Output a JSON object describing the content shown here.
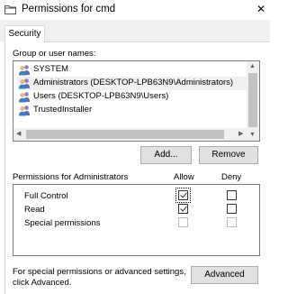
{
  "window": {
    "title": "Permissions for cmd",
    "close_glyph": "✕"
  },
  "tabs": [
    {
      "label": "Security",
      "active": true
    }
  ],
  "users": {
    "label": "Group or user names:",
    "items": [
      {
        "name": "SYSTEM",
        "icon": "users-group-icon",
        "selected": false
      },
      {
        "name": "Administrators (DESKTOP-LPB63N9\\Administrators)",
        "icon": "users-group-icon",
        "selected": true
      },
      {
        "name": "Users (DESKTOP-LPB63N9\\Users)",
        "icon": "users-group-icon",
        "selected": false
      },
      {
        "name": "TrustedInstaller",
        "icon": "users-group-icon",
        "selected": false
      }
    ]
  },
  "buttons": {
    "add": "Add...",
    "remove": "Remove",
    "advanced": "Advanced"
  },
  "permissions": {
    "header": "Permissions for Administrators",
    "allow_header": "Allow",
    "deny_header": "Deny",
    "rows": [
      {
        "name": "Full Control",
        "allow": true,
        "deny": false,
        "disabled": false
      },
      {
        "name": "Read",
        "allow": true,
        "deny": false,
        "disabled": false
      },
      {
        "name": "Special permissions",
        "allow": false,
        "deny": false,
        "disabled": true
      }
    ]
  },
  "advanced_note": {
    "line1": "For special permissions or advanced settings,",
    "line2": "click Advanced."
  },
  "colors": {
    "selected_row": "#f0f0f0",
    "button_face": "#e1e1e1",
    "tab_strip": "#f0f0f0"
  }
}
